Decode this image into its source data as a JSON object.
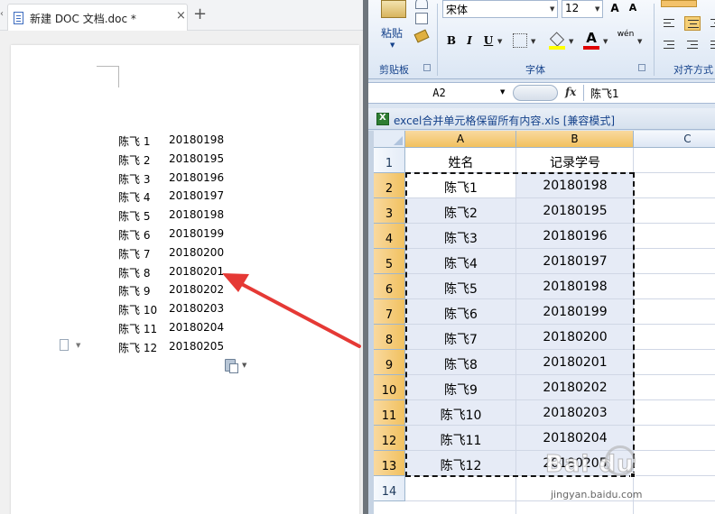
{
  "word": {
    "tab_title": "新建 DOC 文档.doc *",
    "tab_close": "×",
    "tab_add": "+",
    "tab_left_arrow": "‹",
    "lines": [
      {
        "name": "陈飞 1",
        "num": "20180198"
      },
      {
        "name": "陈飞 2",
        "num": "20180195"
      },
      {
        "name": "陈飞 3",
        "num": "20180196"
      },
      {
        "name": "陈飞 4",
        "num": "20180197"
      },
      {
        "name": "陈飞 5",
        "num": "20180198"
      },
      {
        "name": "陈飞 6",
        "num": "20180199"
      },
      {
        "name": "陈飞 7",
        "num": "20180200"
      },
      {
        "name": "陈飞 8",
        "num": "20180201"
      },
      {
        "name": "陈飞 9",
        "num": "20180202"
      },
      {
        "name": "陈飞 10",
        "num": "20180203"
      },
      {
        "name": "陈飞 11",
        "num": "20180204"
      },
      {
        "name": "陈飞 12",
        "num": "20180205"
      }
    ]
  },
  "excel": {
    "ribbon": {
      "paste_label": "粘贴",
      "clipboard_group": "剪贴板",
      "font_name": "宋体",
      "font_size": "12",
      "grow_font": "A",
      "shrink_font": "A",
      "bold": "B",
      "italic": "I",
      "underline": "U",
      "font_color": "A",
      "phonetic": "wén",
      "font_group": "字体",
      "align_group": "对齐方式"
    },
    "namebox": "A2",
    "fx": "fx",
    "formula_value": "陈飞1",
    "workbook_title": "excel合并单元格保留所有内容.xls  [兼容模式]",
    "columns": [
      "A",
      "B",
      "C"
    ],
    "rows": [
      "1",
      "2",
      "3",
      "4",
      "5",
      "6",
      "7",
      "8",
      "9",
      "10",
      "11",
      "12",
      "13",
      "14"
    ],
    "header_row": {
      "a": "姓名",
      "b": "记录学号"
    },
    "data": [
      {
        "a": "陈飞1",
        "b": "20180198"
      },
      {
        "a": "陈飞2",
        "b": "20180195"
      },
      {
        "a": "陈飞3",
        "b": "20180196"
      },
      {
        "a": "陈飞4",
        "b": "20180197"
      },
      {
        "a": "陈飞5",
        "b": "20180198"
      },
      {
        "a": "陈飞6",
        "b": "20180199"
      },
      {
        "a": "陈飞7",
        "b": "20180200"
      },
      {
        "a": "陈飞8",
        "b": "20180201"
      },
      {
        "a": "陈飞9",
        "b": "20180202"
      },
      {
        "a": "陈飞10",
        "b": "20180203"
      },
      {
        "a": "陈飞11",
        "b": "20180204"
      },
      {
        "a": "陈飞12",
        "b": "20180205"
      }
    ]
  },
  "watermark": {
    "logo": "Bai du",
    "url": "jingyan.baidu.com"
  },
  "colors": {
    "arrow": "#e53935",
    "selection_header": "#f5c86e",
    "selection_fill": "#e6ebf6"
  }
}
